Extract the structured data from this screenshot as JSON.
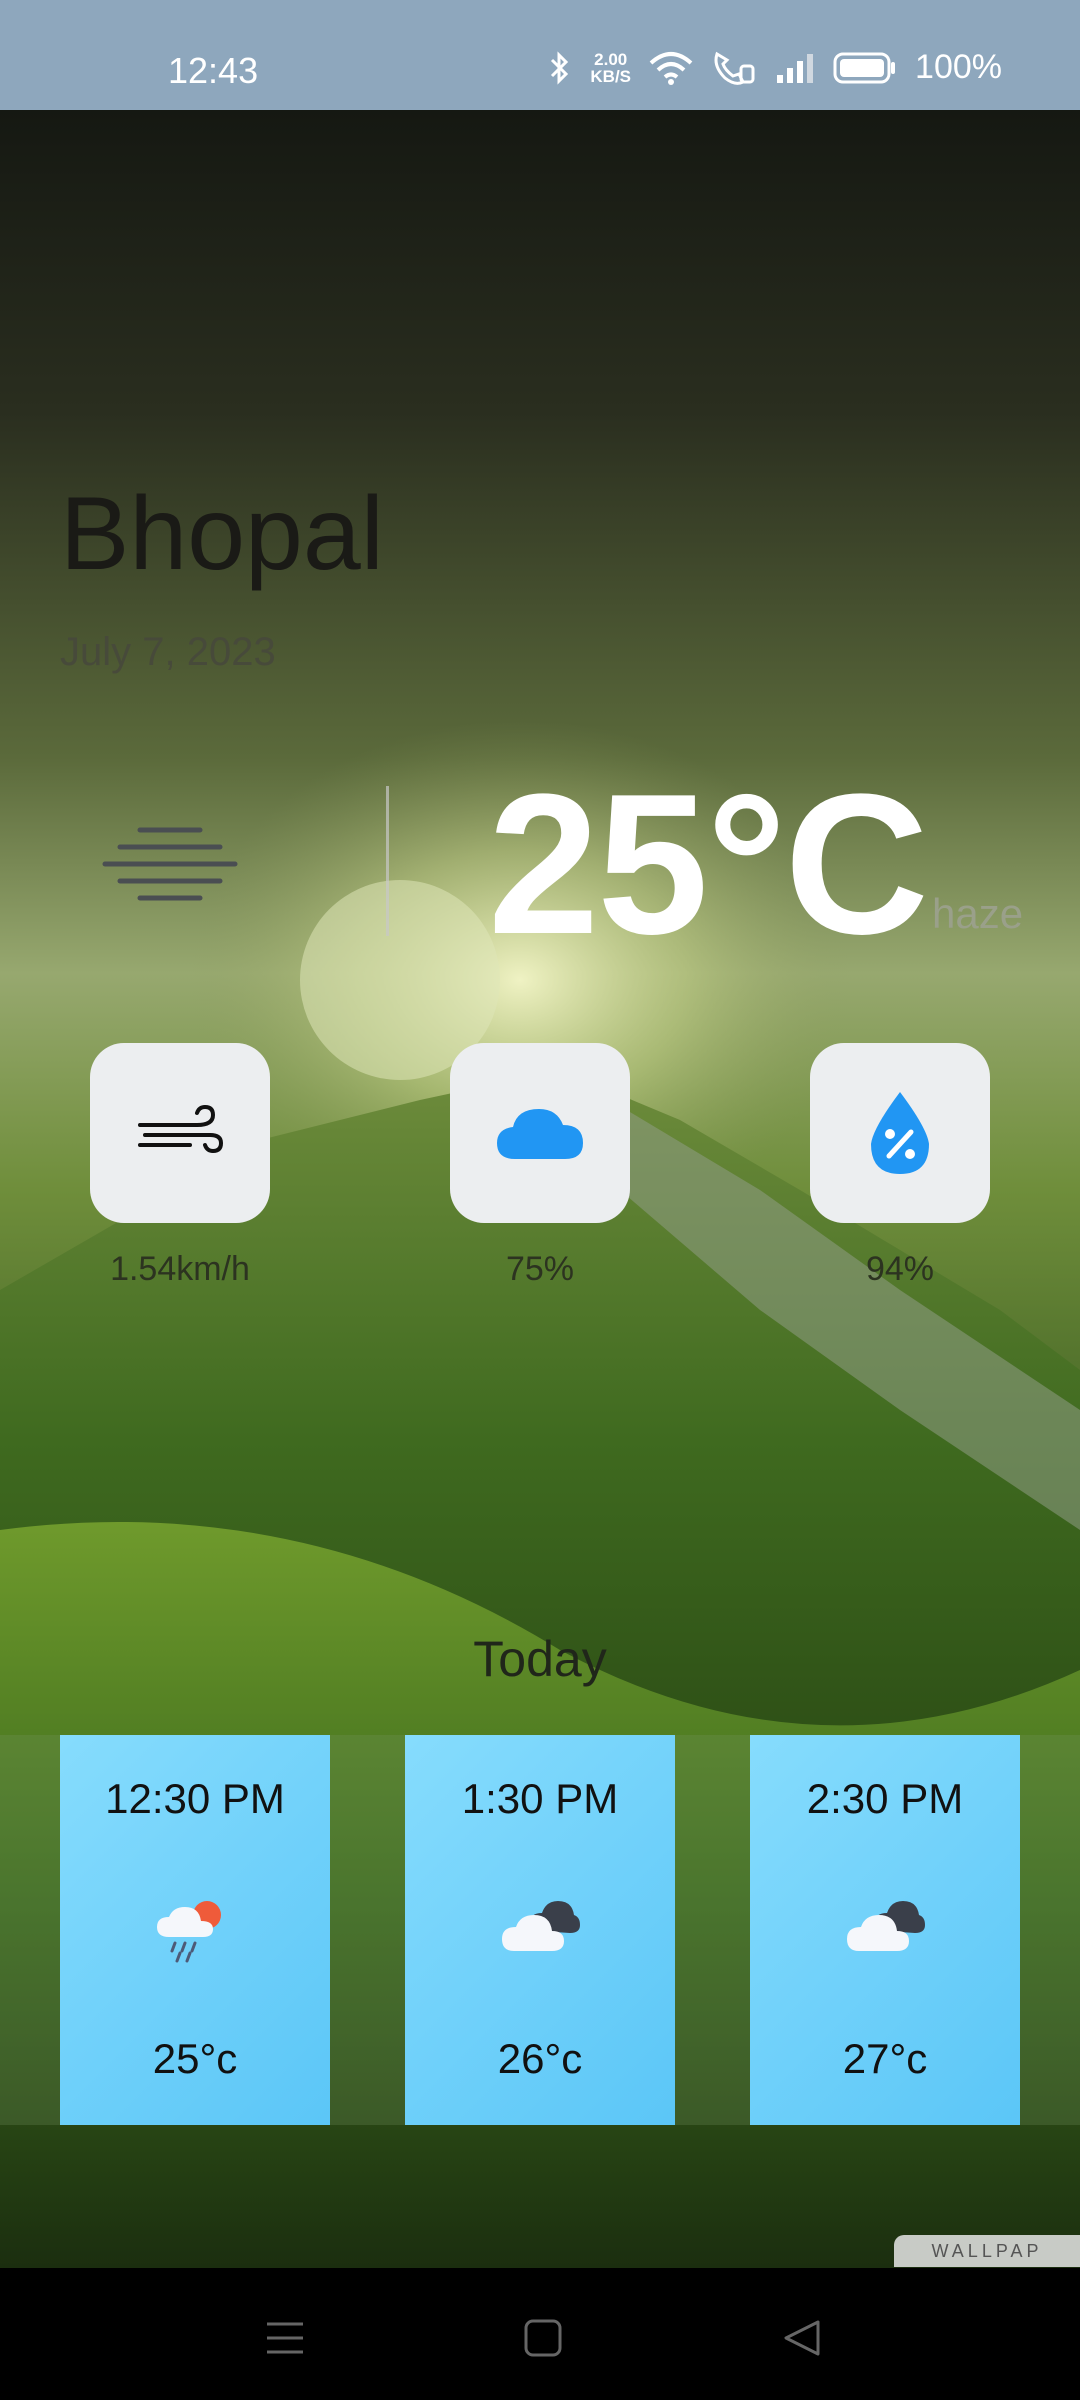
{
  "status_bar": {
    "time": "12:43",
    "net_speed_value": "2.00",
    "net_speed_unit": "KB/S",
    "battery": "100%",
    "icons": [
      "bluetooth-icon",
      "wifi-icon",
      "wifi-calling-icon",
      "signal-icon",
      "battery-icon"
    ]
  },
  "location": {
    "city": "Bhopal",
    "date": "July 7, 2023"
  },
  "current": {
    "temperature": "25°C",
    "condition": "haze",
    "icon": "haze-icon"
  },
  "details": [
    {
      "icon": "wind-icon",
      "value": "1.54km/h"
    },
    {
      "icon": "cloud-icon",
      "value": "75%"
    },
    {
      "icon": "humidity-icon",
      "value": "94%"
    }
  ],
  "today": {
    "title": "Today",
    "hours": [
      {
        "time": "12:30 PM",
        "icon": "rain-sun-icon",
        "temp": "25°c"
      },
      {
        "time": "1:30 PM",
        "icon": "cloudy-icon",
        "temp": "26°c"
      },
      {
        "time": "2:30 PM",
        "icon": "cloudy-icon",
        "temp": "27°c"
      }
    ]
  },
  "watermark": "WALLPAP",
  "nav": [
    "menu-icon",
    "home-icon",
    "back-icon"
  ],
  "colors": {
    "status_bar": "#8ea7bd",
    "card": "#5bc6f7",
    "tile": "#eceef0",
    "accent_blue": "#2196f3"
  }
}
